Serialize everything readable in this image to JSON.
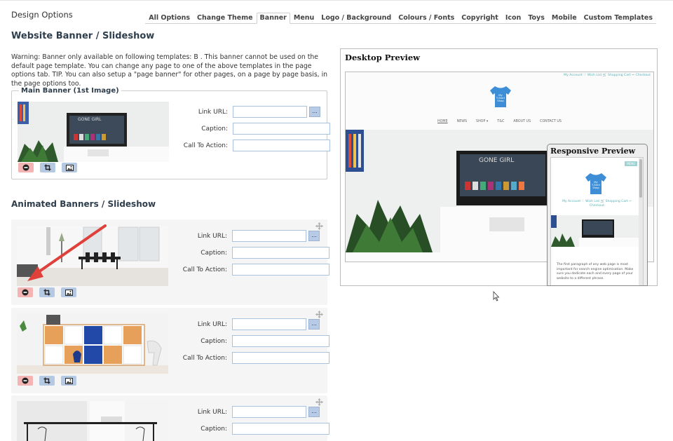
{
  "app": {
    "title": "Design Options"
  },
  "tabs": [
    {
      "label": "All Options"
    },
    {
      "label": "Change Theme"
    },
    {
      "label": "Banner",
      "active": true
    },
    {
      "label": "Menu"
    },
    {
      "label": "Logo / Background"
    },
    {
      "label": "Colours / Fonts"
    },
    {
      "label": "Copyright"
    },
    {
      "label": "Icon"
    },
    {
      "label": "Toys"
    },
    {
      "label": "Mobile"
    },
    {
      "label": "Custom Templates"
    }
  ],
  "page": {
    "title": "Website Banner / Slideshow",
    "warning": "Warning: Banner only available on following templates: B . This banner cannot be used on the default page template. You can change any page to one of the above templates in the page options tab. TIP. You can also setup a \"page banner\" for other pages, on a page by page basis, in the page options too."
  },
  "main_banner": {
    "legend": "Main Banner (1st Image)",
    "link_label": "Link URL:",
    "caption_label": "Caption:",
    "cta_label": "Call To Action:",
    "link_value": "",
    "caption_value": "",
    "cta_value": "",
    "browse_label": "..."
  },
  "animated": {
    "title": "Animated Banners / Slideshow",
    "items": [
      {
        "link_label": "Link URL:",
        "caption_label": "Caption:",
        "cta_label": "Call To Action:",
        "browse_label": "..."
      },
      {
        "link_label": "Link URL:",
        "caption_label": "Caption:",
        "cta_label": "Call To Action:",
        "browse_label": "..."
      },
      {
        "link_label": "Link URL:",
        "caption_label": "Caption:",
        "browse_label": "..."
      }
    ]
  },
  "desktop_preview": {
    "title": "Desktop Preview",
    "top_links": "My Account  ♡ Wish List  🛒 Shopping Cart  ⇨ Checkout",
    "logo_text": "My T-Shirt Shop",
    "nav": [
      "HOME",
      "NEWS",
      "SHOP ▾",
      "T&C",
      "ABOUT US",
      "CONTACT US"
    ],
    "tv_text": "GONE GIRL"
  },
  "responsive_preview": {
    "title": "Responsive Preview",
    "menu_label": "MENU",
    "logo_text": "My T-Shirt Shop",
    "links": "My Account  ♡ Wish List  🛒 Shopping Cart  ⇨ Checkout",
    "paragraph": "The first paragraph of any web page is most important for search engine optimisation. Make sure you dedicate each and every page of your website to a different phrase."
  },
  "colors": {
    "accent": "#2e3e4d",
    "input_border": "#a9c3df",
    "delete_btn": "#f5b4b4",
    "action_btn": "#b6c9e3",
    "arrow": "#e0403a"
  },
  "icons": [
    "minus-icon",
    "crop-icon",
    "image-icon",
    "move-icon",
    "tshirt-icon",
    "cursor-icon"
  ]
}
